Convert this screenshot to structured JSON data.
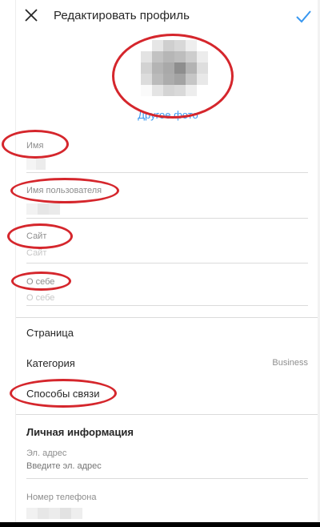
{
  "header": {
    "title": "Редактировать профиль",
    "close_icon": "close-icon",
    "confirm_icon": "checkmark-icon",
    "accent": "#3897f0"
  },
  "avatar": {
    "change_photo_label": "Другое фото"
  },
  "fields": {
    "name": {
      "label": "Имя",
      "value": ""
    },
    "username": {
      "label": "Имя пользователя",
      "value": ""
    },
    "website": {
      "label": "Сайт",
      "placeholder": "Сайт"
    },
    "bio": {
      "label": "О себе",
      "placeholder": "О себе"
    }
  },
  "business": {
    "page_label": "Страница",
    "category_label": "Категория",
    "category_value": "Business",
    "contact_label": "Способы связи"
  },
  "personal": {
    "title": "Личная информация",
    "email_label": "Эл. адрес",
    "email_placeholder": "Введите эл. адрес",
    "phone_label": "Номер телефона"
  },
  "annotation_color": "#d5262c"
}
